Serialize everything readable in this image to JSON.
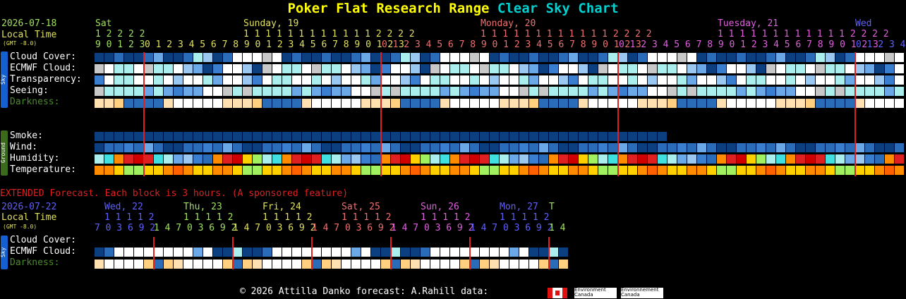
{
  "title": {
    "part1": "Poker Flat Research Range",
    "part2": "Clear Sky Chart"
  },
  "main": {
    "date": "2026-07-18",
    "local_time": "Local Time",
    "gmt": "(GMT -8.0)",
    "days": [
      {
        "label": "Sat",
        "color": "#a0e060"
      },
      {
        "label": "Sunday, 19",
        "color": "#e0e060"
      },
      {
        "label": "Monday, 20",
        "color": "#f07070"
      },
      {
        "label": "Tuesday, 21",
        "color": "#e060e0"
      },
      {
        "label": "Wed",
        "color": "#6060ff"
      }
    ],
    "hour_tens": [
      {
        "text": "1 2 2 2 2",
        "color": "#a0e060"
      },
      {
        "text": "1 1 1 1 1 1 1 1 1 1 1 1 2 2 2 2",
        "color": "#e0e060"
      },
      {
        "text": "1 1 1 1 1 1 1 1 1 1 1 1 2 2 2 2",
        "color": "#f07070"
      },
      {
        "text": "1 1 1 1 1 1 1 1 1 1 1 1 2 2 2 2",
        "color": "#e060e0"
      }
    ],
    "hour_ones": [
      {
        "text": "9 0 1 2 3",
        "color": "#a0e060"
      },
      {
        "text": "0 1 2 3 4 5 6 7 8 9 0 1 2 3 4 5 6 7 8 9 0 1 2 3",
        "color": "#e0e060"
      },
      {
        "text": "0 1 2 3 4 5 6 7 8 9 0 1 2 3 4 5 6 7 8 9 0 1 2 3",
        "color": "#f07070"
      },
      {
        "text": "0 1 2 3 4 5 6 7 8 9 0 1 2 3 4 5 6 7 8 9 0 1 2 3",
        "color": "#e060e0"
      },
      {
        "text": "0 1 2 3 4",
        "color": "#6060ff"
      }
    ],
    "sky_label": "Sky",
    "ground_label": "Ground",
    "rows": {
      "cloud": "Cloud Cover:",
      "ecmwf": "ECMWF Cloud:",
      "transparency": "Transparency:",
      "seeing": "Seeing:",
      "darkness": "Darkness:",
      "smoke": "Smoke:",
      "wind": "Wind:",
      "humidity": "Humidity:",
      "temperature": "Temperature:"
    },
    "colors": {
      "darkblue": "#0b3f80",
      "midblue": "#2a6cb8",
      "blue": "#3a7ed0",
      "lightblue": "#6aa8e8",
      "paleblue": "#9ac8f0",
      "cyan": "#aaeeee",
      "lightgrey": "#c8c8c8",
      "white": "#ffffff",
      "red": "#e02020",
      "orange": "#ff8c00",
      "yellow": "#ffd000",
      "green": "#a0f060",
      "deepred": "#d00000"
    }
  },
  "extended": {
    "banner": "EXTENDED Forecast. Each block is 3 hours. (A sponsored feature)",
    "date": "2026-07-22",
    "local_time": "Local Time",
    "gmt": "(GMT -8.0)",
    "days": [
      {
        "label": "Wed, 22",
        "color": "#6060ff"
      },
      {
        "label": "Thu, 23",
        "color": "#a0e060"
      },
      {
        "label": "Fri, 24",
        "color": "#e0e060"
      },
      {
        "label": "Sat, 25",
        "color": "#f07070"
      },
      {
        "label": "Sun, 26",
        "color": "#e060e0"
      },
      {
        "label": "Mon, 27",
        "color": "#6060ff"
      },
      {
        "label": "T",
        "color": "#a0e060"
      }
    ],
    "hour_tens": [
      {
        "text": "1 1 1 1 2",
        "color": "#6060ff"
      },
      {
        "text": "1 1 1 1 2",
        "color": "#a0e060"
      },
      {
        "text": "1 1 1 1 2",
        "color": "#e0e060"
      },
      {
        "text": "1 1 1 1 2",
        "color": "#f07070"
      },
      {
        "text": "1 1 1 1 2",
        "color": "#e060e0"
      },
      {
        "text": "1 1 1 1 2",
        "color": "#6060ff"
      }
    ],
    "hour_ones": [
      {
        "text": "7 0 3 6 9 2",
        "color": "#6060ff"
      },
      {
        "text": "1 4 7 0 3 6 9 2",
        "color": "#a0e060"
      },
      {
        "text": "1 4 7 0 3 6 9 2",
        "color": "#e0e060"
      },
      {
        "text": "1 4 7 0 3 6 9 2",
        "color": "#f07070"
      },
      {
        "text": "1 4 7 0 3 6 9 2",
        "color": "#e060e0"
      },
      {
        "text": "1 4 7 0 3 6 9 2",
        "color": "#6060ff"
      },
      {
        "text": "1 4",
        "color": "#a0e060"
      }
    ],
    "rows": {
      "cloud": "Cloud Cover:",
      "ecmwf": "ECMWF Cloud:",
      "darkness": "Darkness:"
    }
  },
  "footer": {
    "text": "© 2026 Attilla Danko  forecast: A.Rahill  data:",
    "env1": "Environment Canada",
    "env2": "Environnement Canada"
  }
}
